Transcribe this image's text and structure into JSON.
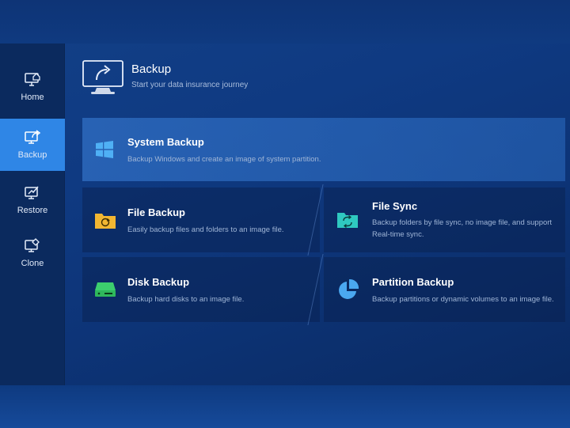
{
  "sidebar": {
    "items": [
      {
        "label": "Home",
        "icon": "home-icon",
        "active": false
      },
      {
        "label": "Backup",
        "icon": "backup-icon",
        "active": true
      },
      {
        "label": "Restore",
        "icon": "restore-icon",
        "active": false
      },
      {
        "label": "Clone",
        "icon": "clone-icon",
        "active": false
      }
    ]
  },
  "header": {
    "title": "Backup",
    "subtitle": "Start your data insurance journey"
  },
  "cards": {
    "system_backup": {
      "title": "System Backup",
      "desc": "Backup Windows and create an image of system partition.",
      "icon": "windows-icon"
    },
    "file_backup": {
      "title": "File Backup",
      "desc": "Easily backup files and folders to an image file.",
      "icon": "folder-backup-icon"
    },
    "file_sync": {
      "title": "File Sync",
      "desc_line1": "Backup folders by file sync, no image file, and support",
      "desc_line2": "Real-time sync.",
      "icon": "folder-sync-icon"
    },
    "disk_backup": {
      "title": "Disk Backup",
      "desc": "Backup hard disks to an image file.",
      "icon": "disk-icon"
    },
    "partition_backup": {
      "title": "Partition Backup",
      "desc": "Backup partitions or dynamic volumes to an image file.",
      "icon": "pie-partition-icon"
    }
  },
  "colors": {
    "accent": "#2f86e6",
    "sidebar_bg": "#0b2a5e",
    "folder_yellow": "#f2b632",
    "sync_teal": "#2fc9c0",
    "disk_green": "#3ccf6e",
    "partition_blue": "#4aa8f0",
    "windows_blue": "#4fb0f5"
  }
}
